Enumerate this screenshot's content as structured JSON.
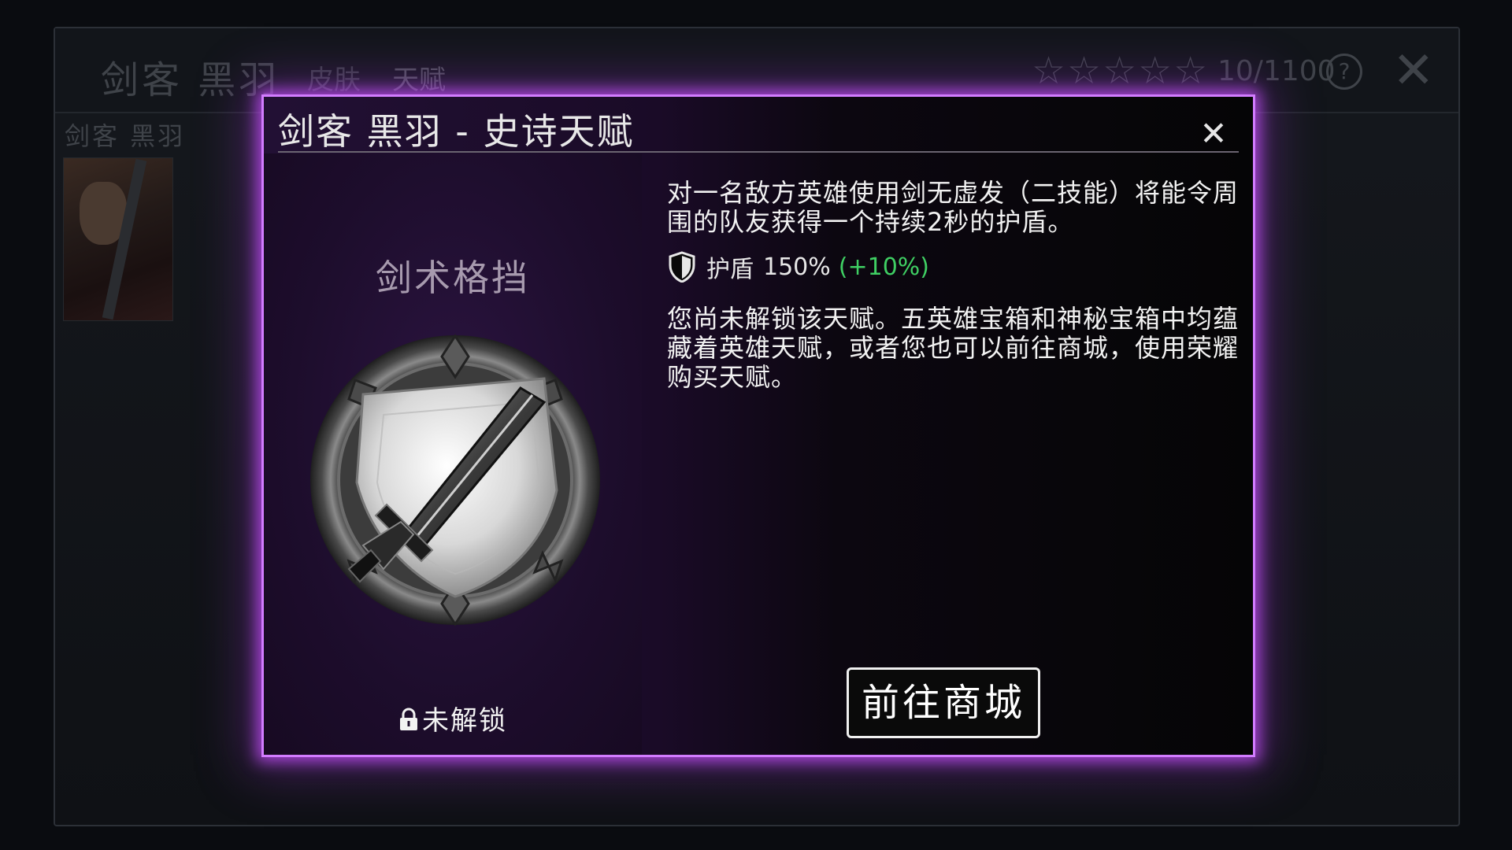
{
  "background": {
    "title": "剑客 黑羽",
    "tabs": [
      "皮肤",
      "天赋"
    ],
    "rating": {
      "stars_filled": 0,
      "stars_total": 5
    },
    "score": "10/1100",
    "help_label": "?",
    "hero_name": "剑客 黑羽"
  },
  "modal": {
    "title": "剑客 黑羽 - 史诗天赋",
    "close_label": "✕",
    "talent_name": "剑术格挡",
    "lock_status": "未解锁",
    "description": "对一名敌方英雄使用剑无虚发（二技能）将能令周围的队友获得一个持续2秒的护盾。",
    "stat": {
      "label": "护盾",
      "value": "150%",
      "bonus": "(+10%)"
    },
    "unlock_info": "您尚未解锁该天赋。五英雄宝箱和神秘宝箱中均蕴藏着英雄天赋，或者您也可以前往商城，使用荣耀购买天赋。",
    "shop_button": "前往商城"
  },
  "colors": {
    "modal_border": "#d27cff",
    "bonus_green": "#3fcf63"
  }
}
